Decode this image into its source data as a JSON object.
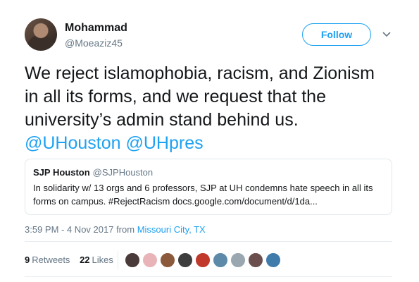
{
  "author": {
    "name": "Mohammad",
    "handle": "@Moeaziz45"
  },
  "follow_label": "Follow",
  "tweet": {
    "lines": [
      "We reject islamophobia, racism, and Zionism",
      "in all its forms, and we request that the",
      "university’s admin stand behind us."
    ],
    "mentions": "@UHouston @UHpres"
  },
  "quote": {
    "name": "SJP Houston",
    "handle": "@SJPHouston",
    "text": "In solidarity w/ 13 orgs and 6 professors, SJP at UH condemns hate speech in all its forms on campus. #RejectRacism docs.google.com/document/d/1da..."
  },
  "timestamp": {
    "time": "3:59 PM - 4 Nov 2017 from ",
    "location": "Missouri City, TX"
  },
  "stats": {
    "retweets_count": "9",
    "retweets_label": "Retweets",
    "likes_count": "22",
    "likes_label": "Likes"
  },
  "liker_avatars": [
    {
      "name": "avatar-1",
      "color": "#4a3a3a"
    },
    {
      "name": "avatar-2",
      "color": "#e8b4b8"
    },
    {
      "name": "avatar-3",
      "color": "#8b5a3c"
    },
    {
      "name": "avatar-4",
      "color": "#3d3d3d"
    },
    {
      "name": "avatar-5",
      "color": "#c0392b"
    },
    {
      "name": "avatar-6",
      "color": "#5d8aa8"
    },
    {
      "name": "avatar-7",
      "color": "#9aa6b0"
    },
    {
      "name": "avatar-8",
      "color": "#6b4f4f"
    },
    {
      "name": "avatar-9",
      "color": "#3f7cac"
    }
  ],
  "colors": {
    "accent": "#1da1f2",
    "text": "#14171a",
    "muted": "#657786"
  }
}
